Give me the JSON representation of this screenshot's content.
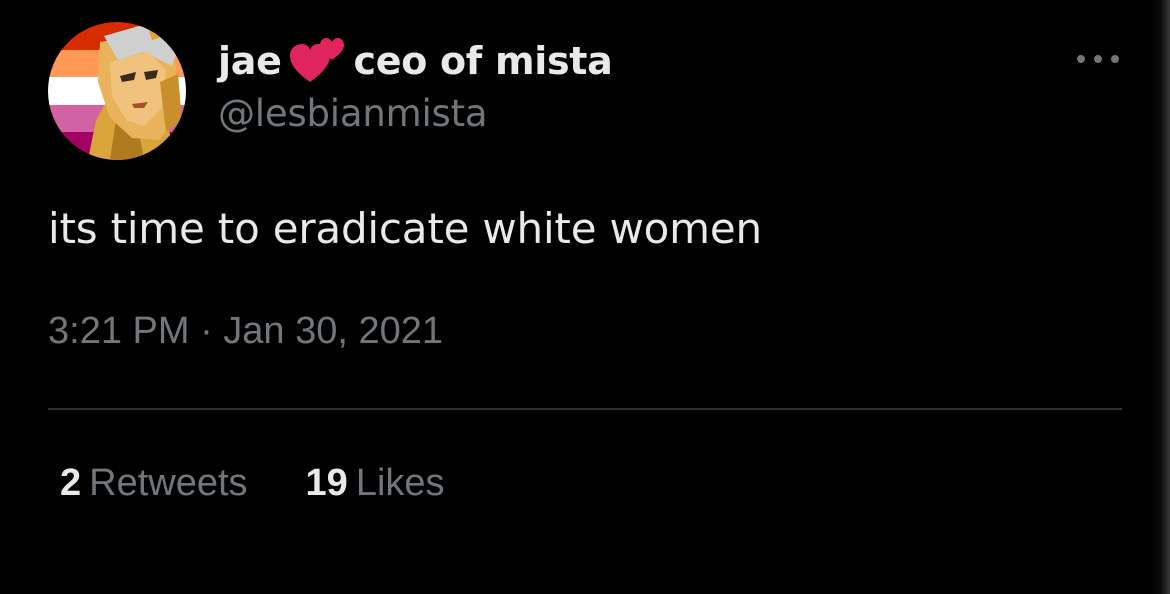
{
  "user": {
    "display_name": "jae",
    "name_suffix": "ceo of mista",
    "handle": "@lesbianmista",
    "avatar_icon": "avatar-lesbian-flag-anime-character",
    "emoji_icon": "two-hearts-icon"
  },
  "tweet": {
    "text": "its time to eradicate white women",
    "timestamp": "3:21 PM · Jan 30, 2021"
  },
  "stats": {
    "retweets_count": "2",
    "retweets_label": "Retweets",
    "likes_count": "19",
    "likes_label": "Likes"
  },
  "colors": {
    "background": "#000000",
    "primary_text": "#e7e9ea",
    "secondary_text": "#71767b",
    "divider": "#2f3336",
    "heart": "#e0245e"
  }
}
